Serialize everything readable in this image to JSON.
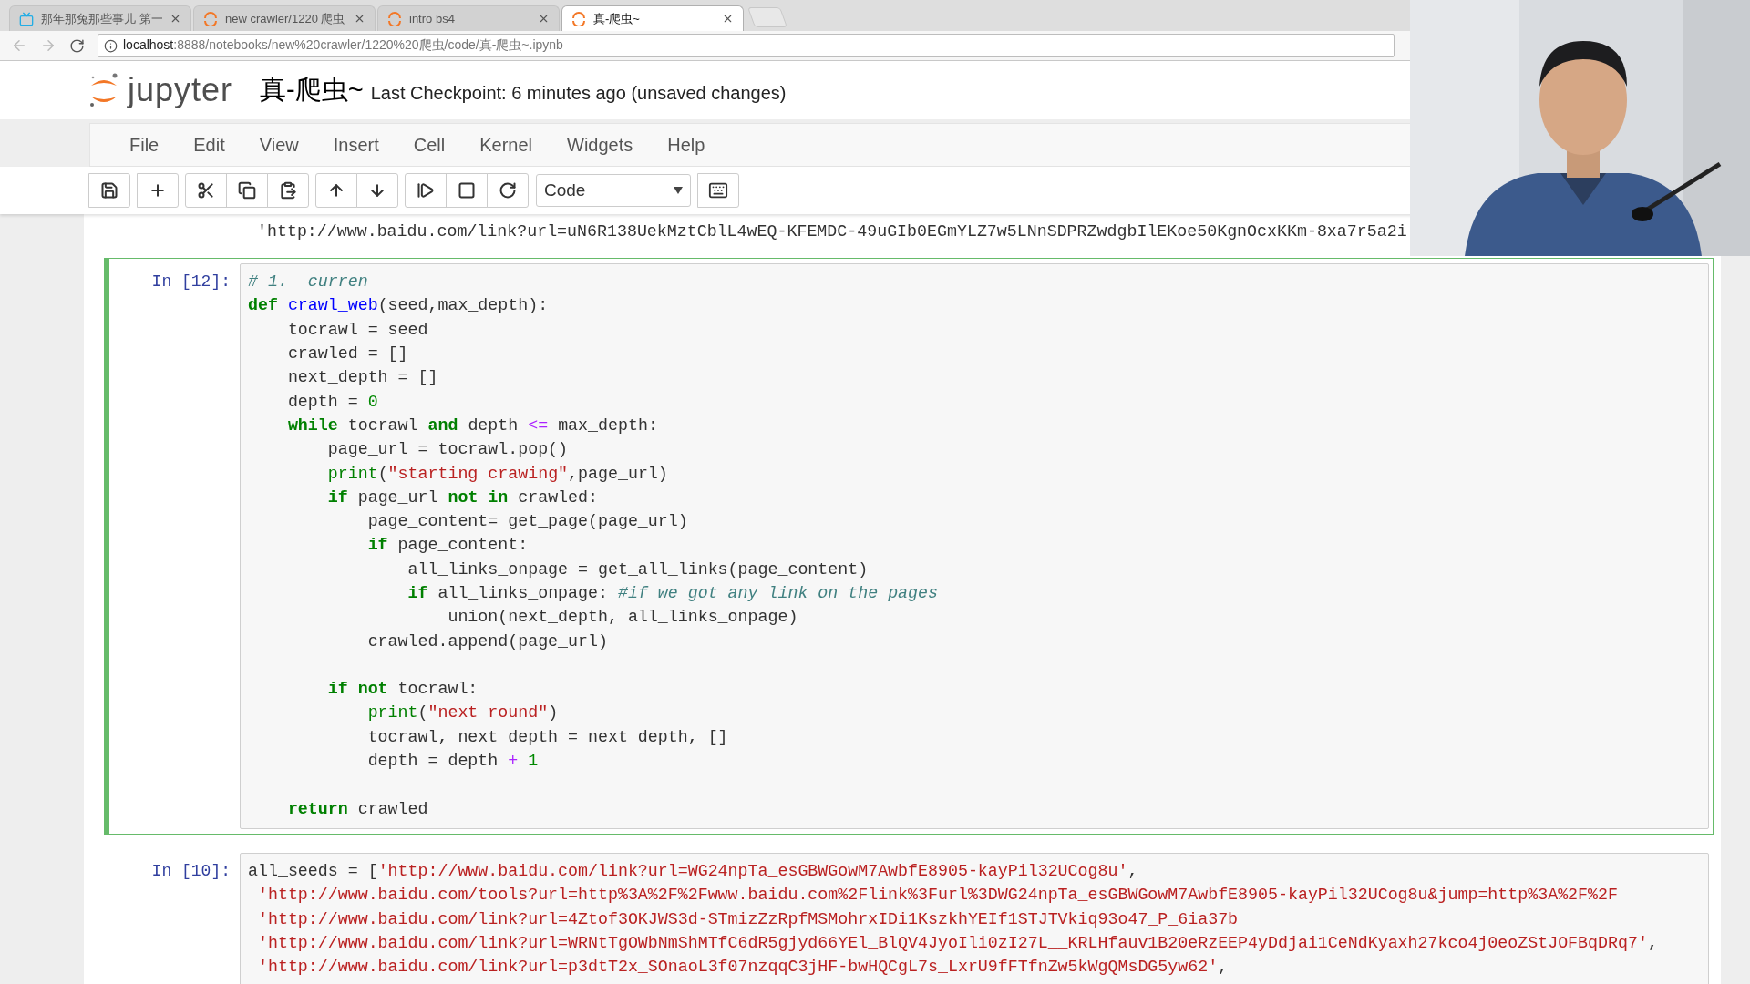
{
  "browser": {
    "tabs": [
      {
        "kind": "video",
        "title": "那年那兔那些事儿 第一",
        "selected": false
      },
      {
        "kind": "notebook",
        "title": "new crawler/1220 爬虫",
        "selected": false
      },
      {
        "kind": "notebook",
        "title": "intro bs4",
        "selected": false
      },
      {
        "kind": "notebook",
        "title": "真-爬虫~",
        "selected": true
      }
    ],
    "url_host": "localhost",
    "url_rest": ":8888/notebooks/new%20crawler/1220%20爬虫/code/真-爬虫~.ipynb"
  },
  "header": {
    "logo_text": "jupyter",
    "notebook_name": "真-爬虫~",
    "checkpoint": "Last Checkpoint: 6 minutes ago (unsaved changes)"
  },
  "menu": [
    "File",
    "Edit",
    "View",
    "Insert",
    "Cell",
    "Kernel",
    "Widgets",
    "Help"
  ],
  "toolbar": {
    "cell_type": "Code"
  },
  "output_above": [
    {
      "kind": "plain",
      "text": "'http://www.baidu.com/link?url=uN6R138UekMztCblL4wEQ-KFEMDC-49uGIb0EGmYLZ7w5LNnSDPRZwdgbIlEKoe50KgnOcxKKm-8xa7r5a2i"
    }
  ],
  "cells": [
    {
      "prompt": "In [12]:",
      "selected": true,
      "lines": [
        {
          "kind": "code",
          "segments": [
            {
              "kind": "comment",
              "text": "# 1.  curren"
            }
          ]
        },
        {
          "kind": "code",
          "segments": [
            {
              "kind": "keyword",
              "text": "def"
            },
            {
              "kind": "function",
              "text": " crawl_web"
            },
            {
              "kind": "plain",
              "text": "(seed,max_depth):"
            }
          ]
        },
        {
          "kind": "code",
          "segments": [
            {
              "kind": "plain",
              "text": "    tocrawl = seed"
            }
          ]
        },
        {
          "kind": "code",
          "segments": [
            {
              "kind": "plain",
              "text": "    crawled = []"
            }
          ]
        },
        {
          "kind": "code",
          "segments": [
            {
              "kind": "plain",
              "text": "    next_depth = []"
            }
          ]
        },
        {
          "kind": "code",
          "segments": [
            {
              "kind": "plain",
              "text": "    depth = "
            },
            {
              "kind": "number",
              "text": "0"
            }
          ]
        },
        {
          "kind": "code",
          "segments": [
            {
              "kind": "keyword",
              "text": "    while"
            },
            {
              "kind": "plain",
              "text": " tocrawl "
            },
            {
              "kind": "keyword",
              "text": "and"
            },
            {
              "kind": "plain",
              "text": " depth "
            },
            {
              "kind": "operator",
              "text": "<="
            },
            {
              "kind": "plain",
              "text": " max_depth:"
            }
          ]
        },
        {
          "kind": "code",
          "segments": [
            {
              "kind": "plain",
              "text": "        page_url = tocrawl.pop()"
            }
          ]
        },
        {
          "kind": "code",
          "segments": [
            {
              "kind": "builtin",
              "text": "        print"
            },
            {
              "kind": "plain",
              "text": "("
            },
            {
              "kind": "string",
              "text": "\"starting crawing\""
            },
            {
              "kind": "plain",
              "text": ",page_url)"
            }
          ]
        },
        {
          "kind": "code",
          "segments": [
            {
              "kind": "keyword",
              "text": "        if"
            },
            {
              "kind": "plain",
              "text": " page_url "
            },
            {
              "kind": "keyword",
              "text": "not in"
            },
            {
              "kind": "plain",
              "text": " crawled:"
            }
          ]
        },
        {
          "kind": "code",
          "segments": [
            {
              "kind": "plain",
              "text": "            page_content= get_page(page_url)"
            }
          ]
        },
        {
          "kind": "code",
          "segments": [
            {
              "kind": "keyword",
              "text": "            if"
            },
            {
              "kind": "plain",
              "text": " page_content:"
            }
          ]
        },
        {
          "kind": "code",
          "segments": [
            {
              "kind": "plain",
              "text": "                all_links_onpage = get_all_links(page_content)"
            }
          ]
        },
        {
          "kind": "code",
          "segments": [
            {
              "kind": "keyword",
              "text": "                if"
            },
            {
              "kind": "plain",
              "text": " all_links_onpage: "
            },
            {
              "kind": "comment",
              "text": "#if we got any link on the pages"
            }
          ]
        },
        {
          "kind": "code",
          "segments": [
            {
              "kind": "plain",
              "text": "                    union(next_depth, all_links_onpage)"
            }
          ]
        },
        {
          "kind": "code",
          "segments": [
            {
              "kind": "plain",
              "text": "            crawled.append(page_url)"
            }
          ]
        },
        {
          "kind": "blank"
        },
        {
          "kind": "code",
          "segments": [
            {
              "kind": "keyword",
              "text": "        if not"
            },
            {
              "kind": "plain",
              "text": " tocrawl:"
            }
          ]
        },
        {
          "kind": "code",
          "segments": [
            {
              "kind": "builtin",
              "text": "            print"
            },
            {
              "kind": "plain",
              "text": "("
            },
            {
              "kind": "string",
              "text": "\"next round\""
            },
            {
              "kind": "plain",
              "text": ")"
            }
          ]
        },
        {
          "kind": "code",
          "segments": [
            {
              "kind": "plain",
              "text": "            tocrawl, next_depth = next_depth, []"
            }
          ]
        },
        {
          "kind": "code",
          "segments": [
            {
              "kind": "plain",
              "text": "            depth = depth "
            },
            {
              "kind": "operator",
              "text": "+"
            },
            {
              "kind": "number",
              "text": " 1"
            }
          ]
        },
        {
          "kind": "blank"
        },
        {
          "kind": "code",
          "segments": [
            {
              "kind": "keyword",
              "text": "    return"
            },
            {
              "kind": "plain",
              "text": " crawled"
            }
          ]
        }
      ]
    },
    {
      "prompt": "In [10]:",
      "selected": false,
      "lines": [
        {
          "kind": "code",
          "segments": [
            {
              "kind": "plain",
              "text": "all_seeds = ["
            },
            {
              "kind": "string",
              "text": "'http://www.baidu.com/link?url=WG24npTa_esGBWGowM7AwbfE8905-kayPil32UCog8u'"
            },
            {
              "kind": "plain",
              "text": ","
            }
          ]
        },
        {
          "kind": "code",
          "segments": [
            {
              "kind": "string",
              "text": " 'http://www.baidu.com/tools?url=http%3A%2F%2Fwww.baidu.com%2Flink%3Furl%3DWG24npTa_esGBWGowM7AwbfE8905-kayPil32UCog8u&jump=http%3A%2F%2F"
            }
          ]
        },
        {
          "kind": "code",
          "segments": [
            {
              "kind": "string",
              "text": " 'http://www.baidu.com/link?url=4Ztof3OKJWS3d-STmizZzRpfMSMohrxIDi1KszkhYEIf1STJTVkiq93o47_P_6ia37b"
            }
          ]
        },
        {
          "kind": "code",
          "segments": [
            {
              "kind": "string",
              "text": " 'http://www.baidu.com/link?url=WRNtTgOWbNmShMTfC6dR5gjyd66YEl_BlQV4JyoIli0zI27L__KRLHfauv1B20eRzEEP4yDdjai1CeNdKyaxh27kco4j0eoZStJOFBqDRq7'"
            },
            {
              "kind": "plain",
              "text": ","
            }
          ]
        },
        {
          "kind": "code",
          "segments": [
            {
              "kind": "string",
              "text": " 'http://www.baidu.com/link?url=p3dtT2x_SOnaoL3f07nzqqC3jHF-bwHQCgL7s_LxrU9fFTfnZw5kWgQMsDG5yw62'"
            },
            {
              "kind": "plain",
              "text": ","
            }
          ]
        }
      ]
    }
  ]
}
